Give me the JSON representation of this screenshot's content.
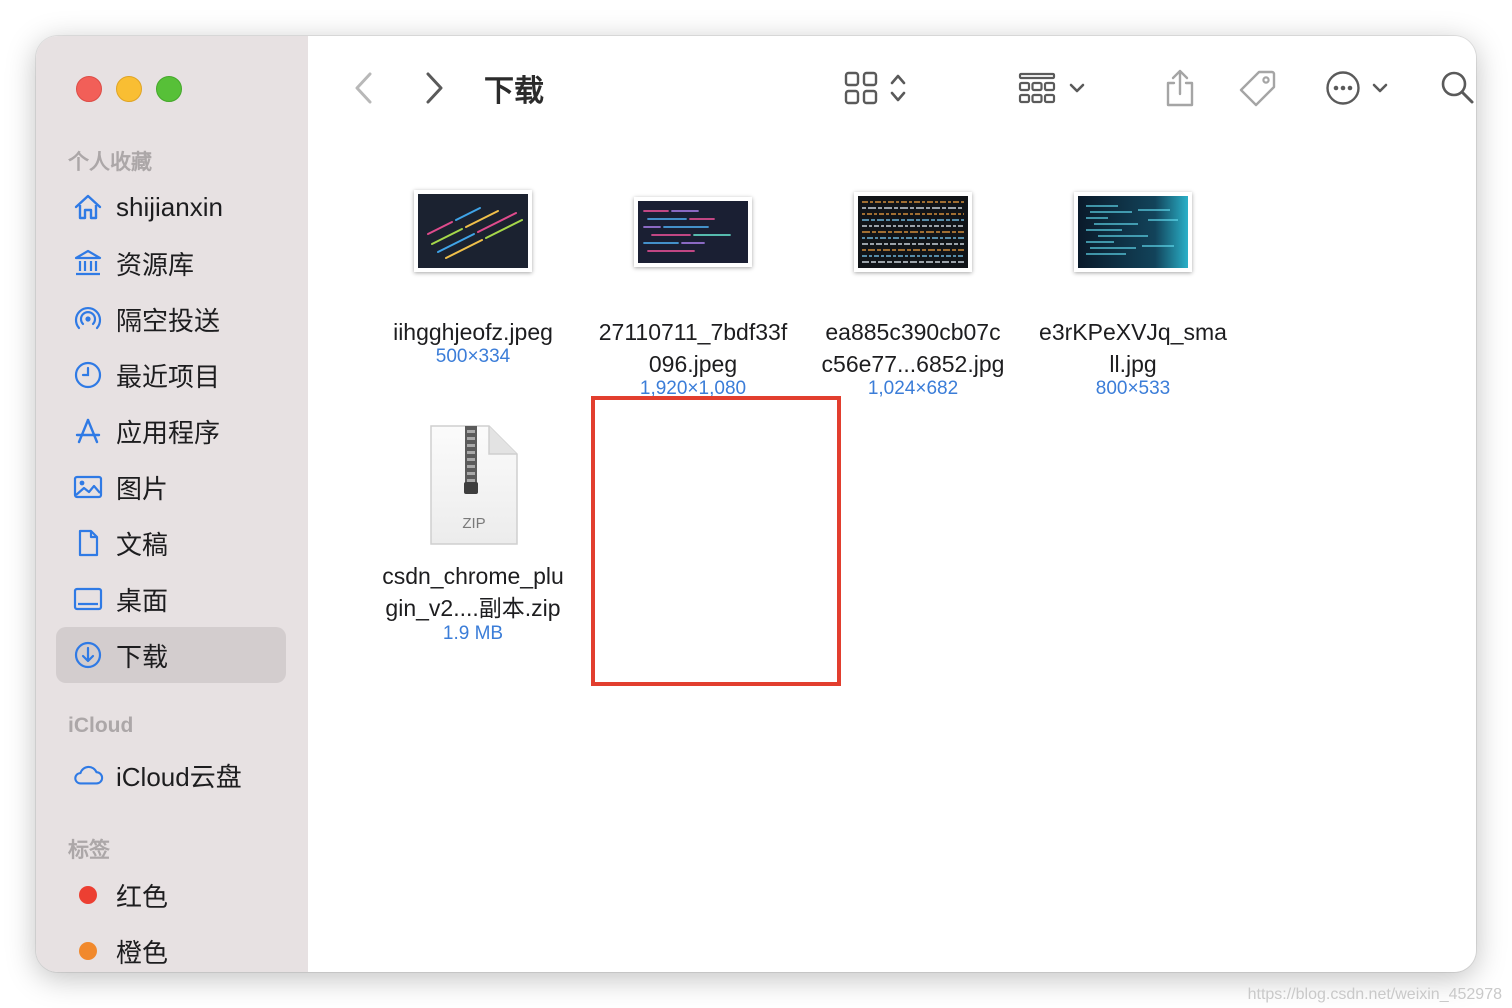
{
  "window": {
    "title": "下载"
  },
  "sidebar": {
    "favorites_title": "个人收藏",
    "favorites": [
      {
        "label": "shijianxin",
        "icon": "home-icon"
      },
      {
        "label": "资源库",
        "icon": "library-icon"
      },
      {
        "label": "隔空投送",
        "icon": "airdrop-icon"
      },
      {
        "label": "最近项目",
        "icon": "clock-icon"
      },
      {
        "label": "应用程序",
        "icon": "applications-icon"
      },
      {
        "label": "图片",
        "icon": "photo-icon"
      },
      {
        "label": "文稿",
        "icon": "document-icon"
      },
      {
        "label": "桌面",
        "icon": "desktop-icon"
      },
      {
        "label": "下载",
        "icon": "download-icon",
        "selected": true
      }
    ],
    "icloud_title": "iCloud",
    "icloud": [
      {
        "label": "iCloud云盘",
        "icon": "cloud-icon"
      }
    ],
    "tags_title": "标签",
    "tags": [
      {
        "label": "红色",
        "color": "#ec3f32"
      },
      {
        "label": "橙色",
        "color": "#f1892c"
      }
    ]
  },
  "toolbar": {
    "back": "chevron-left-icon",
    "forward": "chevron-right-icon",
    "view": "grid-view-icon",
    "group": "group-icon",
    "share": "share-icon",
    "tag": "tag-icon",
    "more": "more-icon",
    "search": "search-icon"
  },
  "files": [
    {
      "name_line1": "iihgghjeofz.jpeg",
      "name_line2": "",
      "meta": "500×334"
    },
    {
      "name_line1": "27110711_7bdf33f",
      "name_line2": "096.jpeg",
      "meta": "1,920×1,080"
    },
    {
      "name_line1": "ea885c390cb07c",
      "name_line2": "c56e77...6852.jpg",
      "meta": "1,024×682"
    },
    {
      "name_line1": "e3rKPeXVJq_sma",
      "name_line2": "ll.jpg",
      "meta": "800×533"
    },
    {
      "name_line1": "csdn_chrome_plu",
      "name_line2": "gin_v2....副本.zip",
      "meta": "1.9 MB",
      "badge": "ZIP"
    }
  ],
  "watermark": "https://blog.csdn.net/weixin_452978",
  "colors": {
    "accent": "#3b7dd8",
    "highlight": "#e23e2e",
    "sidebar": "#e7e1e2"
  }
}
